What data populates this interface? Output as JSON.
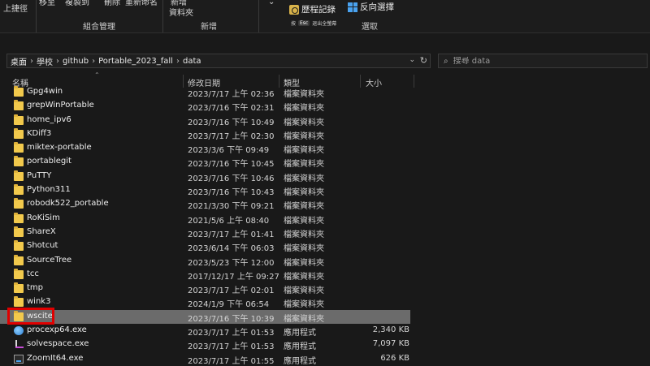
{
  "ribbon": {
    "top_cut_items": [
      "上捷徑",
      "移至",
      "複製到",
      "刪除",
      "重新命名",
      "新增",
      "資料夾"
    ],
    "groups": [
      "組合管理",
      "新增",
      "選取"
    ],
    "history_label": "歷程記錄",
    "invert_label": "反向選擇",
    "shortcut_key": "Esc",
    "shortcut_text": "退出全螢幕"
  },
  "address": {
    "crumbs": [
      "桌面",
      "學校",
      "github",
      "Portable_2023_fall",
      "data"
    ],
    "search_placeholder": "搜尋 data"
  },
  "columns": {
    "name": "名稱",
    "date": "修改日期",
    "type": "類型",
    "size": "大小"
  },
  "rows": [
    {
      "name": "Gpg4win",
      "date": "2023/7/17 上午 02:36",
      "type": "檔案資料夾",
      "size": ""
    },
    {
      "name": "grepWinPortable",
      "date": "2023/7/16 下午 02:31",
      "type": "檔案資料夾",
      "size": ""
    },
    {
      "name": "home_ipv6",
      "date": "2023/7/16 下午 10:49",
      "type": "檔案資料夾",
      "size": ""
    },
    {
      "name": "KDiff3",
      "date": "2023/7/17 上午 02:30",
      "type": "檔案資料夾",
      "size": ""
    },
    {
      "name": "miktex-portable",
      "date": "2023/3/6 下午 09:49",
      "type": "檔案資料夾",
      "size": ""
    },
    {
      "name": "portablegit",
      "date": "2023/7/16 下午 10:45",
      "type": "檔案資料夾",
      "size": ""
    },
    {
      "name": "PuTTY",
      "date": "2023/7/16 下午 10:46",
      "type": "檔案資料夾",
      "size": ""
    },
    {
      "name": "Python311",
      "date": "2023/7/16 下午 10:43",
      "type": "檔案資料夾",
      "size": ""
    },
    {
      "name": "robodk522_portable",
      "date": "2021/3/30 下午 09:21",
      "type": "檔案資料夾",
      "size": ""
    },
    {
      "name": "RoKiSim",
      "date": "2021/5/6 上午 08:40",
      "type": "檔案資料夾",
      "size": ""
    },
    {
      "name": "ShareX",
      "date": "2023/7/17 上午 01:41",
      "type": "檔案資料夾",
      "size": ""
    },
    {
      "name": "Shotcut",
      "date": "2023/6/14 下午 06:03",
      "type": "檔案資料夾",
      "size": ""
    },
    {
      "name": "SourceTree",
      "date": "2023/5/23 下午 12:00",
      "type": "檔案資料夾",
      "size": ""
    },
    {
      "name": "tcc",
      "date": "2017/12/17 上午 09:27",
      "type": "檔案資料夾",
      "size": ""
    },
    {
      "name": "tmp",
      "date": "2023/7/17 上午 02:01",
      "type": "檔案資料夾",
      "size": ""
    },
    {
      "name": "wink3",
      "date": "2024/1/9 下午 06:54",
      "type": "檔案資料夾",
      "size": ""
    },
    {
      "name": "wscite",
      "date": "2023/7/16 下午 10:39",
      "type": "檔案資料夾",
      "size": ""
    },
    {
      "name": "procexp64.exe",
      "date": "2023/7/17 上午 01:53",
      "type": "應用程式",
      "size": "2,340 KB"
    },
    {
      "name": "solvespace.exe",
      "date": "2023/7/17 上午 01:53",
      "type": "應用程式",
      "size": "7,097 KB"
    },
    {
      "name": "ZoomIt64.exe",
      "date": "2023/7/17 上午 01:55",
      "type": "應用程式",
      "size": "626 KB"
    }
  ]
}
